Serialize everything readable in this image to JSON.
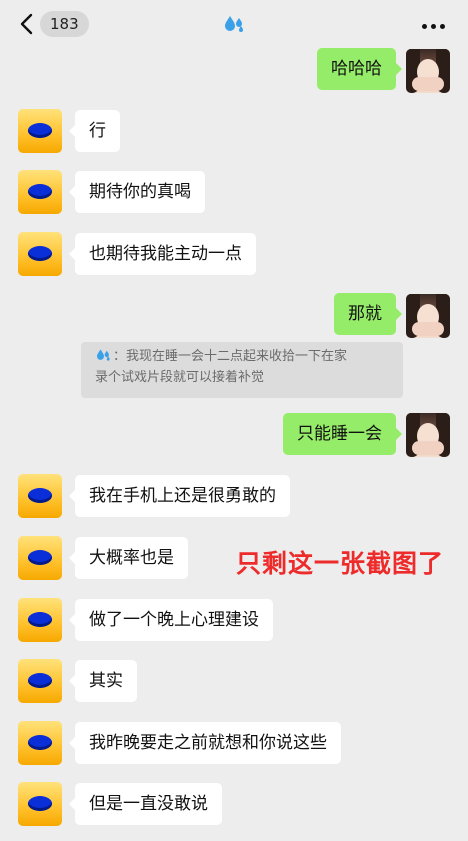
{
  "header": {
    "back_count": "183",
    "contact_icon": "sweat-droplets-icon",
    "more_icon": "more-dots-icon"
  },
  "messages": [
    {
      "side": "right",
      "text": "哈哈哈"
    },
    {
      "side": "left",
      "text": "行"
    },
    {
      "side": "left",
      "text": "期待你的真喝"
    },
    {
      "side": "left",
      "text": "也期待我能主动一点"
    },
    {
      "side": "right",
      "text": "那就"
    },
    {
      "side": "right",
      "text": "只能睡一会"
    },
    {
      "side": "left",
      "text": "我在手机上还是很勇敢的"
    },
    {
      "side": "left",
      "text": "大概率也是"
    },
    {
      "side": "left",
      "text": "做了一个晚上心理建设"
    },
    {
      "side": "left",
      "text": "其实"
    },
    {
      "side": "left",
      "text": "我昨晚要走之前就想和你说这些"
    },
    {
      "side": "left",
      "text": "但是一直没敢说"
    }
  ],
  "quote": {
    "sender_icon": "sweat-droplets-icon",
    "line1": "：我现在睡一会十二点起来收拾一下在家",
    "line2": "录个试戏片段就可以接着补觉"
  },
  "overlay_text": "只剩这一张截图了",
  "colors": {
    "background": "#ededed",
    "outgoing_bubble": "#95ec69",
    "incoming_bubble": "#ffffff",
    "overlay_text": "#ee2b2b"
  }
}
